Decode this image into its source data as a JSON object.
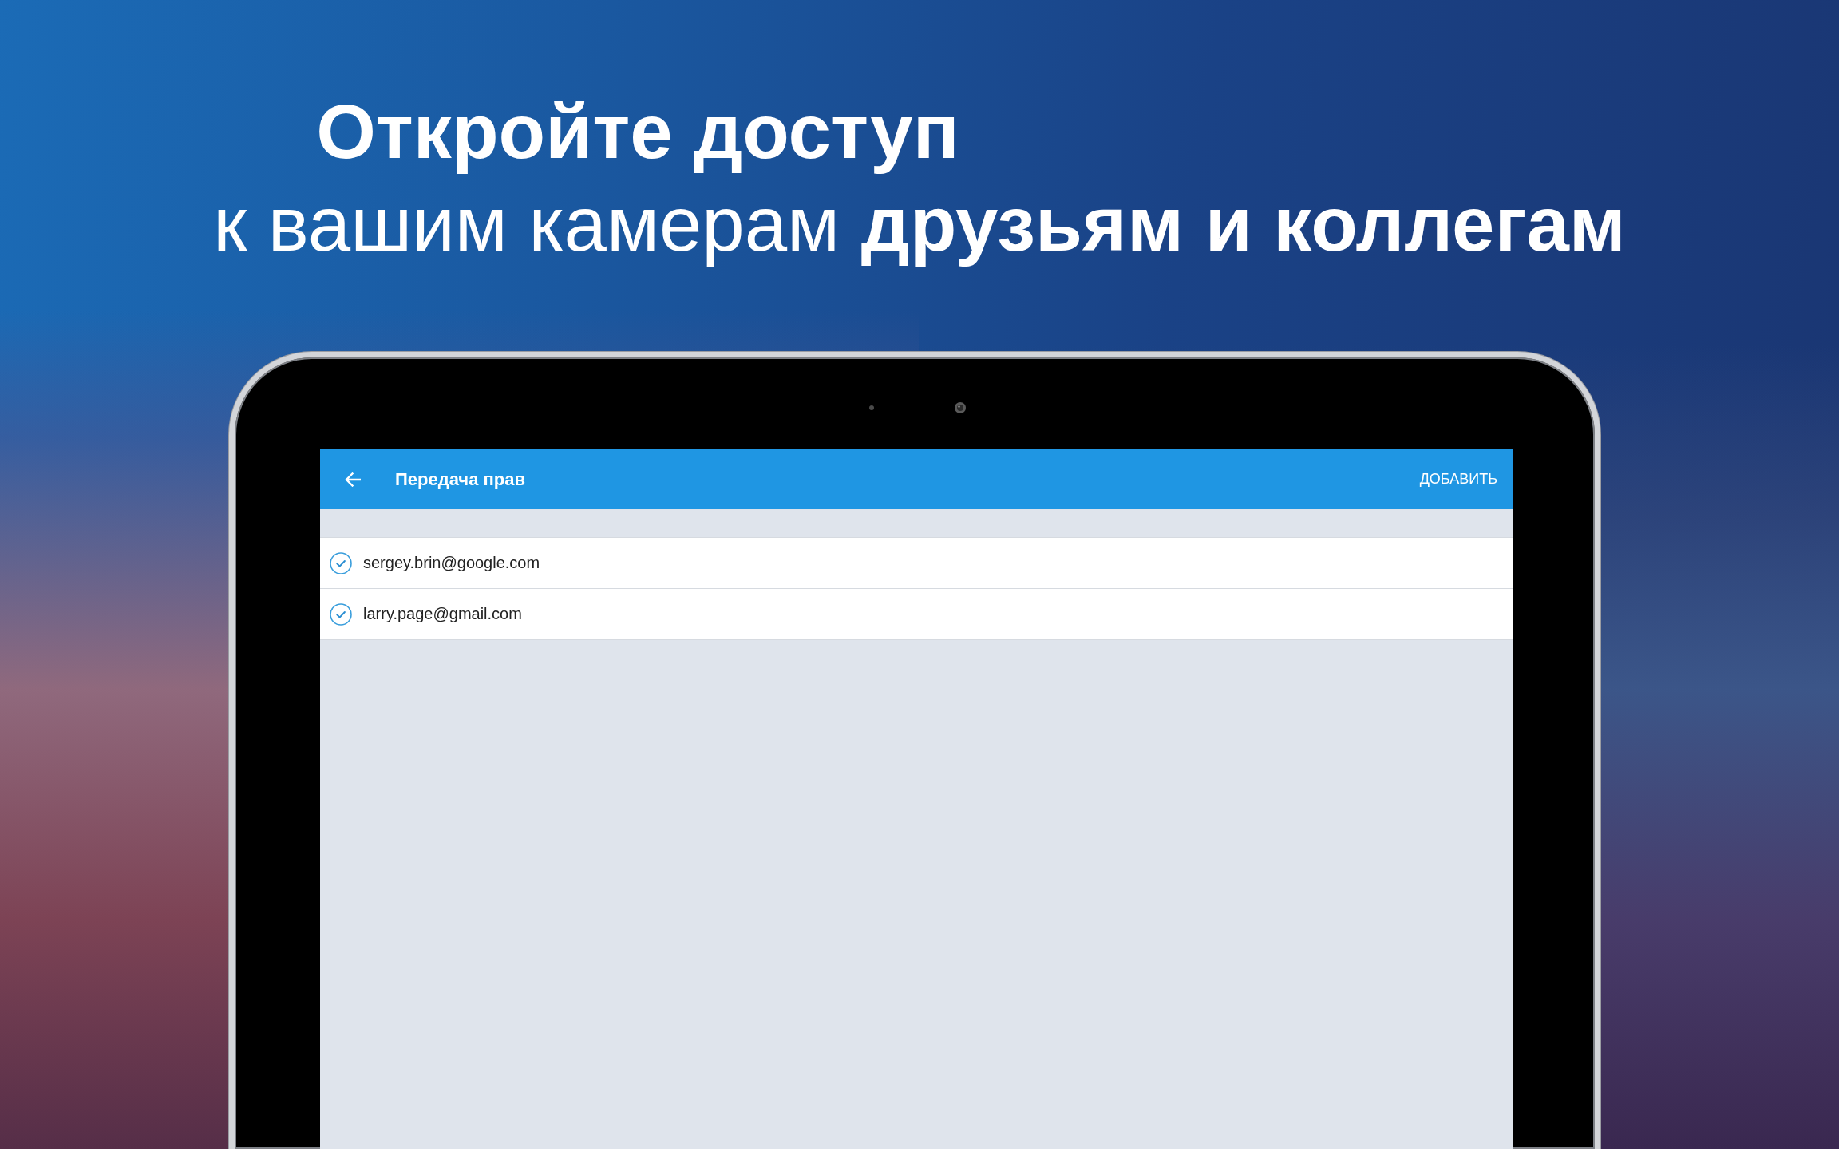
{
  "headline": {
    "title": "Откройте доступ",
    "subtitle": "к вашим камерам **друзьям и коллегам**"
  },
  "app_bar": {
    "title": "Передача прав",
    "action": "ДОБАВИТЬ"
  },
  "users": [
    {
      "email": "sergey.brin@google.com",
      "checked": true
    },
    {
      "email": "larry.page@gmail.com",
      "checked": true
    }
  ]
}
